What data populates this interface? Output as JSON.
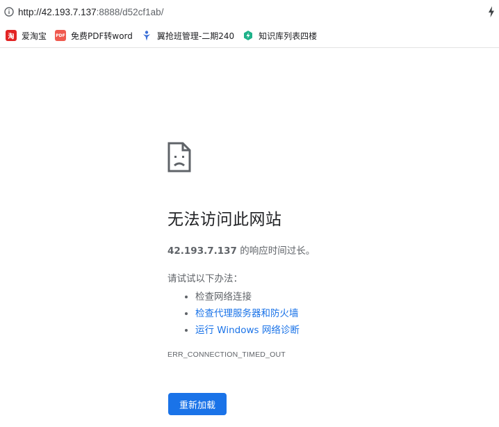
{
  "address_bar": {
    "url_host": "http://42.193.7.137",
    "url_rest": ":8888/d52cf1ab/"
  },
  "bookmarks": [
    {
      "label": "爱淘宝",
      "icon": "taobao-icon"
    },
    {
      "label": "免费PDF转word",
      "icon": "pdf-icon"
    },
    {
      "label": "翼抢班管理-二期240",
      "icon": "person-icon"
    },
    {
      "label": "知识库列表四楼",
      "icon": "knowledge-base-icon"
    }
  ],
  "error": {
    "title": "无法访问此网站",
    "host": "42.193.7.137",
    "summary_suffix": " 的响应时间过长。",
    "try_label": "请试试以下办法：",
    "suggestions": [
      {
        "text": "检查网络连接",
        "link": false
      },
      {
        "text": "检查代理服务器和防火墙",
        "link": true
      },
      {
        "text": "运行 Windows 网络诊断",
        "link": true
      }
    ],
    "code": "ERR_CONNECTION_TIMED_OUT",
    "reload_label": "重新加载"
  },
  "colors": {
    "accent": "#1a73e8",
    "text_secondary": "#5f6368"
  }
}
